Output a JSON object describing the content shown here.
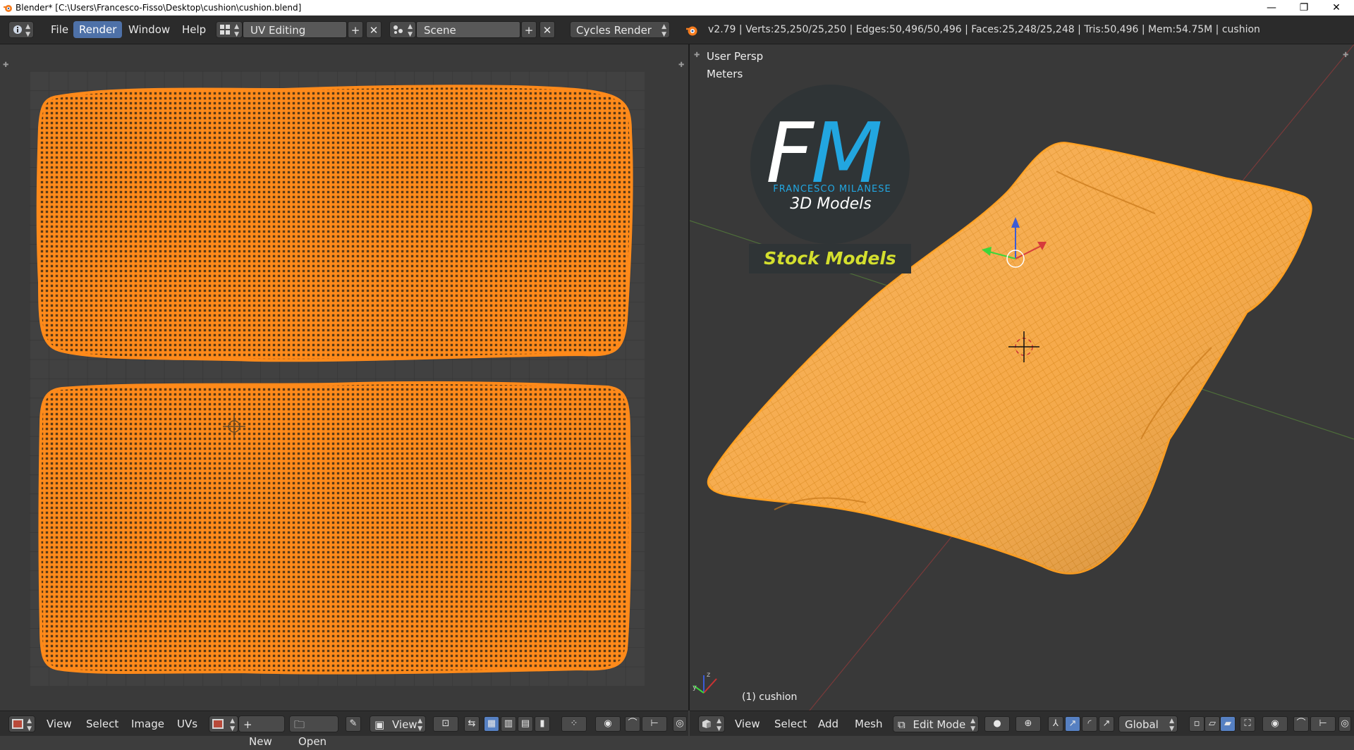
{
  "window": {
    "title": "Blender* [C:\\Users\\Francesco-Fisso\\Desktop\\cushion\\cushion.blend]",
    "minimize_glyph": "—",
    "maximize_glyph": "❐",
    "close_glyph": "✕"
  },
  "info_header": {
    "menus": [
      {
        "label": "File"
      },
      {
        "label": "Render"
      },
      {
        "label": "Window"
      },
      {
        "label": "Help"
      }
    ],
    "screen_layout": "UV Editing",
    "scene": "Scene",
    "render_engine": "Cycles Render",
    "stats": "v2.79 | Verts:25,250/25,250 | Edges:50,496/50,496 | Faces:25,248/25,248 | Tris:50,496 | Mem:54.75M | cushion"
  },
  "uv_editor": {
    "header": {
      "menus": [
        "View",
        "Select",
        "Image",
        "UVs"
      ],
      "new_label": "New",
      "open_label": "Open",
      "view_label": "View"
    }
  },
  "viewport": {
    "view_name": "User Persp",
    "units": "Meters",
    "object_label": "(1) cushion",
    "watermark": {
      "logo_letters_f": "F",
      "logo_letters_m": "M",
      "name": "FRANCESCO MILANESE",
      "subtitle": "3D Models",
      "tagline": "Stock Models"
    },
    "header": {
      "menus": [
        "View",
        "Select",
        "Add",
        "Mesh"
      ],
      "mode": "Edit Mode",
      "orientation": "Global"
    }
  },
  "colors": {
    "accent": "#4e71a8",
    "uv_wire": "#ff8a1a",
    "mesh_fill": "#f5a540",
    "logo_blue": "#22a6e0",
    "tagline_yellow": "#d4df2e"
  }
}
